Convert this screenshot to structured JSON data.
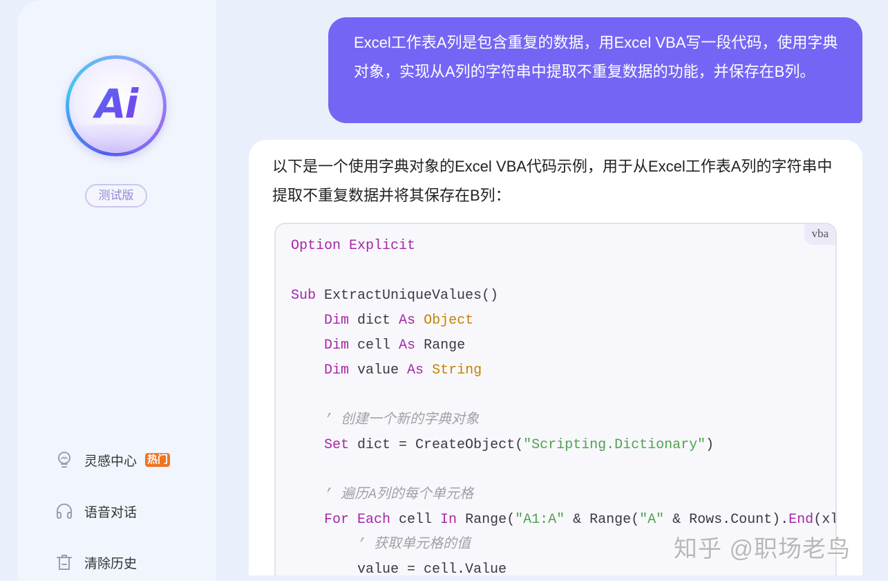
{
  "sidebar": {
    "logo_text": "Ai",
    "beta_badge": "测试版",
    "nav": [
      {
        "label": "灵感中心",
        "icon": "lightbulb-icon",
        "badge": "热门"
      },
      {
        "label": "语音对话",
        "icon": "headphones-icon"
      },
      {
        "label": "清除历史",
        "icon": "trash-icon"
      }
    ],
    "colors": {
      "hot_badge": "#ee7423",
      "accent": "#7565f5"
    }
  },
  "chat": {
    "user_message": "Excel工作表A列是包含重复的数据，用Excel VBA写一段代码，使用字典对象，实现从A列的字符串中提取不重复数据的功能，并保存在B列。",
    "answer_intro": "以下是一个使用字典对象的Excel VBA代码示例，用于从Excel工作表A列的字符串中提取不重复数据并将其保存在B列：",
    "code": {
      "language": "vba",
      "lines": [
        [
          {
            "t": "kw",
            "v": "Option Explicit"
          }
        ],
        [],
        [
          {
            "t": "kw",
            "v": "Sub"
          },
          {
            "t": "",
            "v": " ExtractUniqueValues()"
          }
        ],
        [
          {
            "t": "",
            "v": "    "
          },
          {
            "t": "kw",
            "v": "Dim"
          },
          {
            "t": "",
            "v": " dict "
          },
          {
            "t": "kw",
            "v": "As"
          },
          {
            "t": "",
            "v": " "
          },
          {
            "t": "ty",
            "v": "Object"
          }
        ],
        [
          {
            "t": "",
            "v": "    "
          },
          {
            "t": "kw",
            "v": "Dim"
          },
          {
            "t": "",
            "v": " cell "
          },
          {
            "t": "kw",
            "v": "As"
          },
          {
            "t": "",
            "v": " Range"
          }
        ],
        [
          {
            "t": "",
            "v": "    "
          },
          {
            "t": "kw",
            "v": "Dim"
          },
          {
            "t": "",
            "v": " value "
          },
          {
            "t": "kw",
            "v": "As"
          },
          {
            "t": "",
            "v": " "
          },
          {
            "t": "ty",
            "v": "String"
          }
        ],
        [],
        [
          {
            "t": "",
            "v": "    "
          },
          {
            "t": "cm",
            "v": "’ 创建一个新的字典对象"
          }
        ],
        [
          {
            "t": "",
            "v": "    "
          },
          {
            "t": "kw",
            "v": "Set"
          },
          {
            "t": "",
            "v": " dict = CreateObject("
          },
          {
            "t": "str",
            "v": "\"Scripting.Dictionary\""
          },
          {
            "t": "",
            "v": ")"
          }
        ],
        [],
        [
          {
            "t": "",
            "v": "    "
          },
          {
            "t": "cm",
            "v": "’ 遍历A列的每个单元格"
          }
        ],
        [
          {
            "t": "",
            "v": "    "
          },
          {
            "t": "kw",
            "v": "For Each"
          },
          {
            "t": "",
            "v": " cell "
          },
          {
            "t": "kw",
            "v": "In"
          },
          {
            "t": "",
            "v": " Range("
          },
          {
            "t": "str",
            "v": "\"A1:A\""
          },
          {
            "t": "",
            "v": " & Range("
          },
          {
            "t": "str",
            "v": "\"A\""
          },
          {
            "t": "",
            "v": " & Rows.Count)."
          },
          {
            "t": "kw",
            "v": "End"
          },
          {
            "t": "",
            "v": "(xl"
          }
        ],
        [
          {
            "t": "",
            "v": "        "
          },
          {
            "t": "cm",
            "v": "’ 获取单元格的值"
          }
        ],
        [
          {
            "t": "",
            "v": "        value = cell.Value"
          }
        ]
      ]
    }
  },
  "watermark": "知乎 @职场老鸟"
}
